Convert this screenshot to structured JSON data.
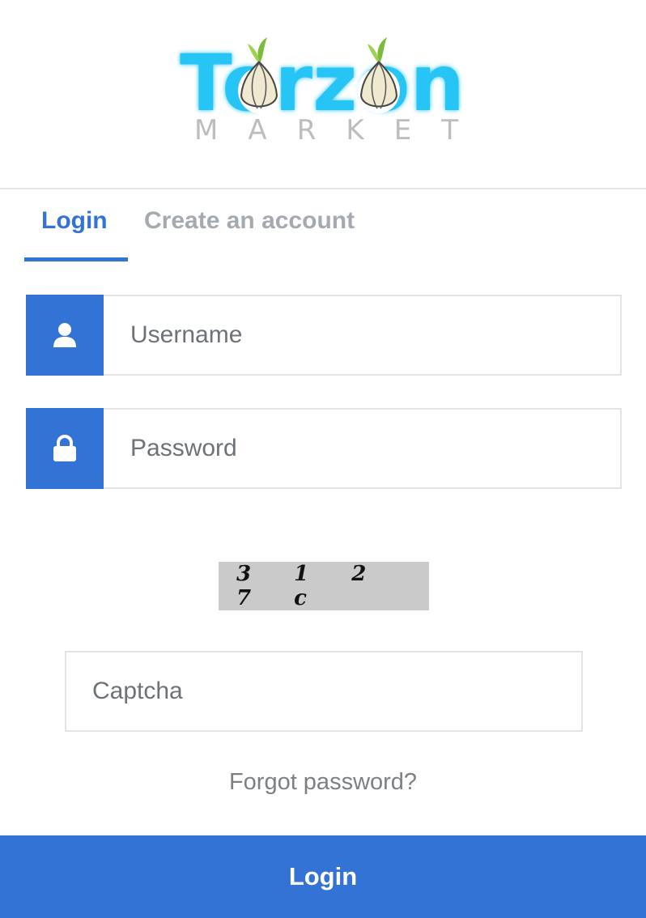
{
  "brand": {
    "logo_word": "Torzon",
    "logo_sub": "MARKET",
    "accent_color": "#27c5f5"
  },
  "tabs": [
    {
      "label": "Login",
      "active": true
    },
    {
      "label": "Create an account",
      "active": false
    }
  ],
  "form": {
    "username": {
      "placeholder": "Username",
      "value": "",
      "icon": "user-icon"
    },
    "password": {
      "placeholder": "Password",
      "value": "",
      "icon": "lock-icon"
    },
    "captcha_image_text": "3 1 2 7 c",
    "captcha": {
      "placeholder": "Captcha",
      "value": ""
    },
    "forgot_label": "Forgot password?",
    "submit_label": "Login"
  },
  "colors": {
    "primary": "#3373d5",
    "tab_inactive": "#a5aab1",
    "border": "#e1e3e6"
  }
}
